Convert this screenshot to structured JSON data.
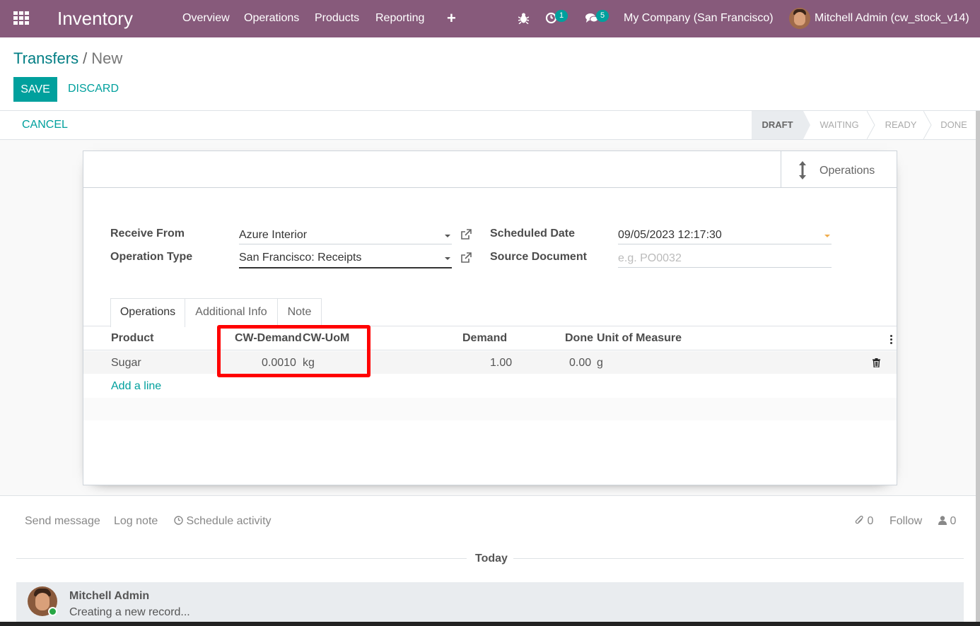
{
  "topbar": {
    "app_name": "Inventory",
    "menu": [
      "Overview",
      "Operations",
      "Products",
      "Reporting"
    ],
    "activity_count": "1",
    "message_count": "5",
    "company": "My Company (San Francisco)",
    "user": "Mitchell Admin (cw_stock_v14)",
    "color": "#875a7b"
  },
  "breadcrumb": {
    "parent": "Transfers",
    "separator": "/",
    "current": "New"
  },
  "actions": {
    "save": "SAVE",
    "discard": "DISCARD",
    "cancel": "CANCEL"
  },
  "statusbar": {
    "steps": [
      "DRAFT",
      "WAITING",
      "READY",
      "DONE"
    ],
    "active": "DRAFT"
  },
  "smart_button": {
    "label": "Operations",
    "icon": "arrows-v-icon"
  },
  "form": {
    "receive_from_label": "Receive From",
    "receive_from_value": "Azure Interior",
    "operation_type_label": "Operation Type",
    "operation_type_value": "San Francisco: Receipts",
    "scheduled_date_label": "Scheduled Date",
    "scheduled_date_value": "09/05/2023 12:17:30",
    "source_document_label": "Source Document",
    "source_document_placeholder": "e.g. PO0032"
  },
  "tabs": [
    "Operations",
    "Additional Info",
    "Note"
  ],
  "table": {
    "headers": {
      "product": "Product",
      "cw_demand": "CW-Demand",
      "cw_uom": "CW-UoM",
      "demand": "Demand",
      "done": "Done",
      "uom": "Unit of Measure"
    },
    "rows": [
      {
        "product": "Sugar",
        "cw_demand": "0.0010",
        "cw_uom": "kg",
        "demand": "1.00",
        "done": "0.00",
        "uom": "g"
      }
    ],
    "add_line": "Add a line"
  },
  "chatter": {
    "send_message": "Send message",
    "log_note": "Log note",
    "schedule_activity": "Schedule activity",
    "attachments": "0",
    "follow": "Follow",
    "followers": "0",
    "date_separator": "Today",
    "messages": [
      {
        "author": "Mitchell Admin",
        "body": "Creating a new record..."
      }
    ]
  },
  "accent_color": "#00a09d",
  "highlight_color": "#ff0000"
}
